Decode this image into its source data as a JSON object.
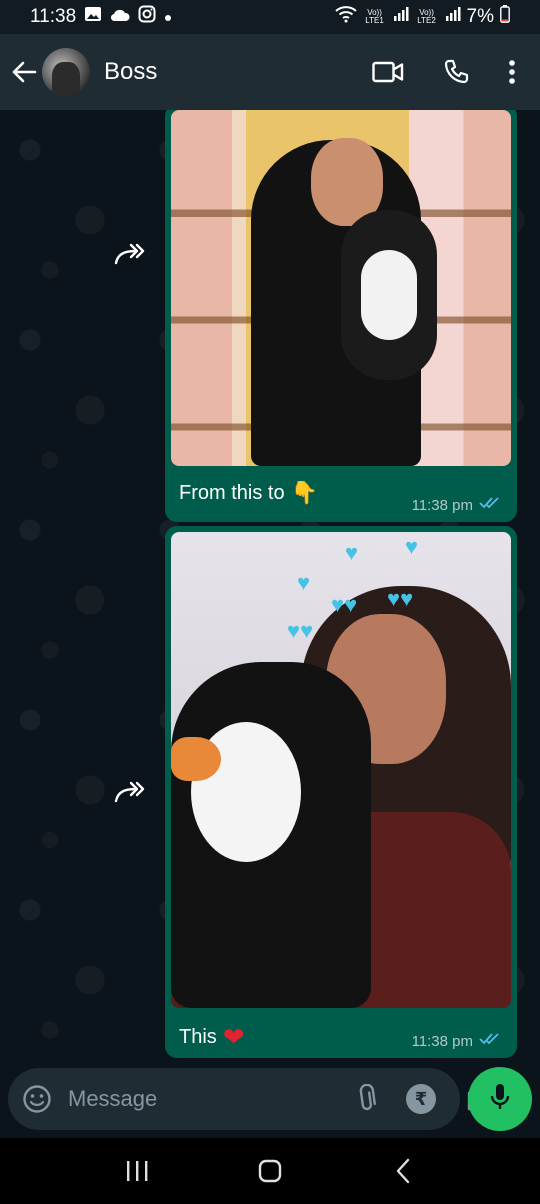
{
  "status": {
    "time": "11:38",
    "sim1_label": "Vo)) LTE1",
    "sim2_label": "Vo)) LTE2",
    "battery": "7%"
  },
  "header": {
    "contact_name": "Boss"
  },
  "messages": [
    {
      "caption": "From this to",
      "emoji": "👇",
      "time": "11:38 pm",
      "status": "read"
    },
    {
      "caption": "This",
      "emoji": "❤",
      "time": "11:38 pm",
      "status": "read"
    }
  ],
  "composer": {
    "placeholder": "Message",
    "payment_symbol": "₹"
  },
  "colors": {
    "header_bg": "#1f2c34",
    "outgoing_bubble": "#005c4b",
    "read_ticks": "#53bdeb",
    "mic_button": "#21c063"
  }
}
